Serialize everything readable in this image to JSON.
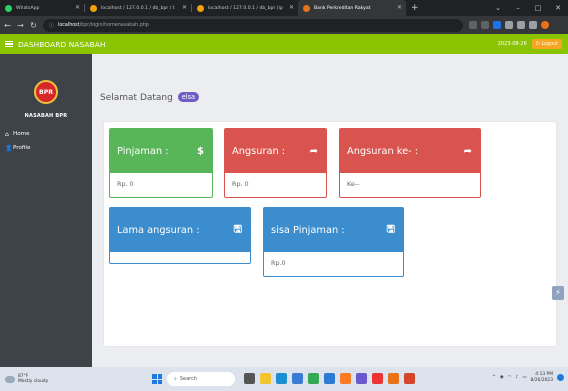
{
  "browser": {
    "tabs": [
      {
        "title": "WhatsApp",
        "favicon_color": "#25d366"
      },
      {
        "title": "localhost / 127.0.0.1 / db_bpr / t",
        "favicon_color": "#f0a30a"
      },
      {
        "title": "localhost / 127.0.0.1 / db_bpr (ip",
        "favicon_color": "#f0a30a"
      },
      {
        "title": "Bank Perkreditan Rakyat",
        "favicon_color": "#e8711a"
      }
    ],
    "new_tab": "+",
    "url_host": "localhost",
    "url_path": "/bpr/login/homenasabah.php",
    "window_controls": [
      "⌄",
      "–",
      "□",
      "✕"
    ]
  },
  "app": {
    "title": "DASHBOARD NASABAH",
    "date": "2023-08-26",
    "logout_label": "Logout",
    "accent": "#8bc403"
  },
  "sidebar": {
    "logo_text": "BPR",
    "title": "NASABAH BPR",
    "items": [
      {
        "label": "Home",
        "icon": "home-icon"
      },
      {
        "label": "Profile",
        "icon": "user-icon"
      }
    ]
  },
  "main": {
    "welcome": "Selamat Datang",
    "username": "elsa",
    "cards": [
      {
        "label": "Pinjaman :",
        "value": "Rp. 0",
        "icon": "dollar-icon",
        "color": "#58b658"
      },
      {
        "label": "Angsuran :",
        "value": "Rp. 0",
        "icon": "share-icon",
        "color": "#d9534f"
      },
      {
        "label": "Angsuran ke- :",
        "value": "Ke--",
        "icon": "share-icon",
        "color": "#d9534f"
      },
      {
        "label": "Lama angsuran :",
        "value": "",
        "icon": "save-icon",
        "color": "#3c8dcd"
      },
      {
        "label": "sisa Pinjaman :",
        "value": "Rp.0",
        "icon": "save-icon",
        "color": "#3c8dcd"
      }
    ]
  },
  "taskbar": {
    "temp": "87°F",
    "weather": "Mostly cloudy",
    "search_placeholder": "Search",
    "time": "4:13 PM",
    "date": "8/26/2023"
  }
}
